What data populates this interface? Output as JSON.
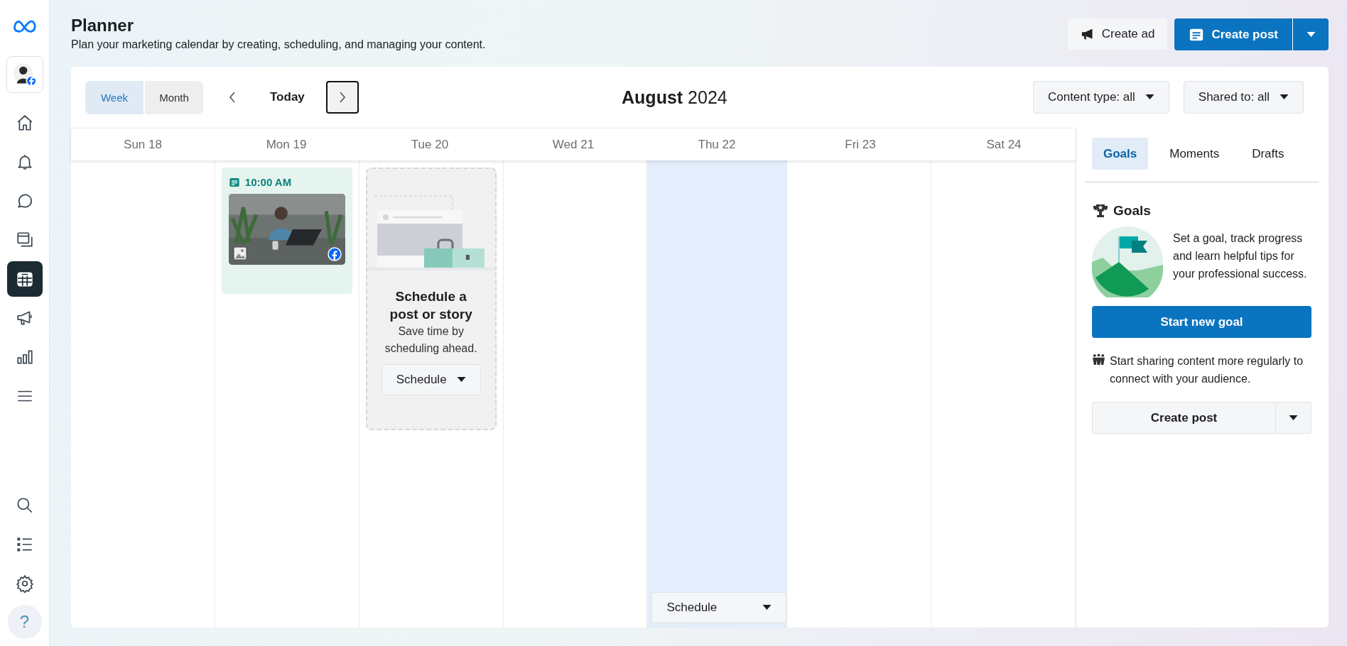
{
  "sidebar": {
    "items": [
      {
        "selected": false
      },
      {
        "selected": false
      },
      {
        "selected": false
      },
      {
        "selected": false
      },
      {
        "selected": true
      },
      {
        "selected": false
      },
      {
        "selected": false
      },
      {
        "selected": false
      }
    ],
    "bottom_items": [
      {
        "selected": false
      },
      {
        "selected": false
      },
      {
        "selected": false
      }
    ],
    "help_label": "?"
  },
  "header": {
    "title": "Planner",
    "subtitle": "Plan your marketing calendar by creating, scheduling, and managing your content.",
    "create_ad": "Create ad",
    "create_post": "Create post"
  },
  "toolbar": {
    "views": [
      {
        "label": "Week",
        "selected": true
      },
      {
        "label": "Month",
        "selected": false
      }
    ],
    "today": "Today",
    "next_focused": true,
    "month": "August",
    "year": "2024",
    "filters": [
      "Content type: all",
      "Shared to: all"
    ]
  },
  "days": [
    {
      "label": "Sun 18",
      "highlighted": false
    },
    {
      "label": "Mon 19",
      "highlighted": false,
      "content": {
        "kind": "post",
        "time": "10:00 AM"
      }
    },
    {
      "label": "Tue 20",
      "highlighted": false,
      "content": {
        "kind": "prompt",
        "title": "Schedule a post or story",
        "text": "Save time by scheduling ahead.",
        "button": "Schedule"
      }
    },
    {
      "label": "Wed 21",
      "highlighted": false
    },
    {
      "label": "Thu 22",
      "highlighted": true,
      "content": {
        "kind": "schedule",
        "button": "Schedule"
      }
    },
    {
      "label": "Fri 23",
      "highlighted": false
    },
    {
      "label": "Sat 24",
      "highlighted": false
    }
  ],
  "panel": {
    "tabs": [
      {
        "label": "Goals",
        "selected": true
      },
      {
        "label": "Moments",
        "selected": false
      },
      {
        "label": "Drafts",
        "selected": false
      }
    ],
    "heading": "Goals",
    "intro": "Set a goal, track progress and learn helpful tips for your professional success.",
    "start_button": "Start new goal",
    "tip": "Start sharing content more regularly to connect with your audience.",
    "create_post": "Create post"
  }
}
